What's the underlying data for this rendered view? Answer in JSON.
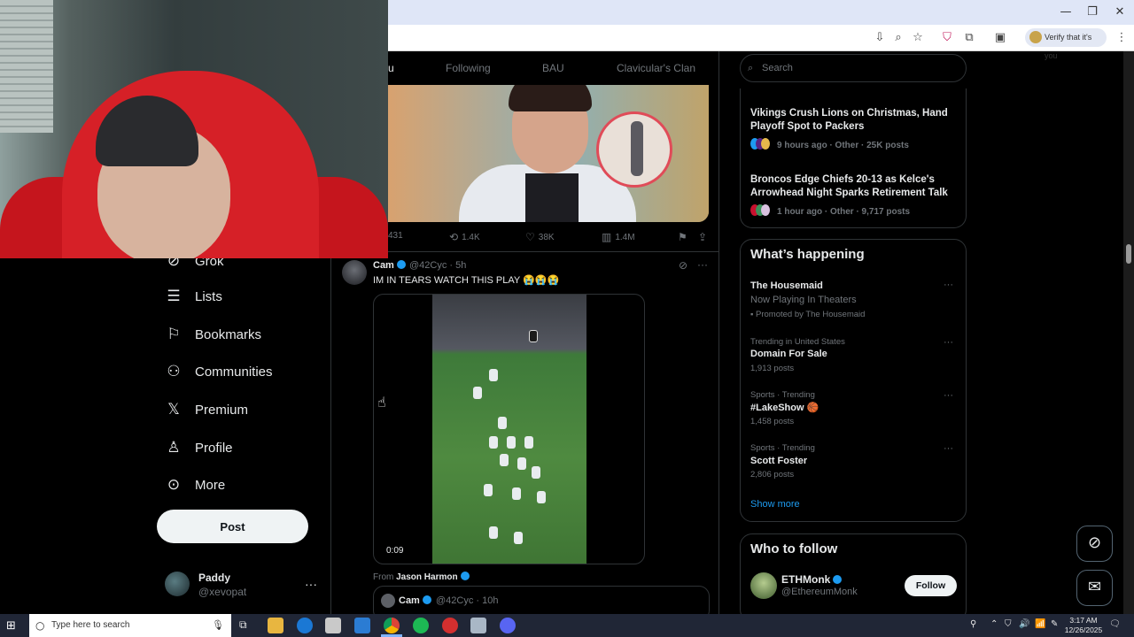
{
  "browser": {
    "verify_label": "Verify that it's you",
    "window_controls": [
      "—",
      "❐",
      "✕"
    ]
  },
  "feed_tabs": [
    {
      "label": "u"
    },
    {
      "label": "Following"
    },
    {
      "label": "BAU"
    },
    {
      "label": "Clavicular's Clan"
    }
  ],
  "post1_actions": {
    "replies": "431",
    "reposts": "1.4K",
    "likes": "38K",
    "views": "1.4M"
  },
  "post2": {
    "name": "Cam",
    "handle": "@42Cyc",
    "time": "5h",
    "text": "IM IN TEARS WATCH THIS PLAY 😭😭😭",
    "video_time": "0:09",
    "from_label": "From",
    "from_name": "Jason Harmon",
    "quote_name": "Cam",
    "quote_handle": "@42Cyc",
    "quote_time": "10h"
  },
  "sidebar": {
    "items": [
      {
        "label": "Grok",
        "icon": "grok-icon"
      },
      {
        "label": "Lists",
        "icon": "list-icon"
      },
      {
        "label": "Bookmarks",
        "icon": "bookmark-icon"
      },
      {
        "label": "Communities",
        "icon": "communities-icon"
      },
      {
        "label": "Premium",
        "icon": "x-icon"
      },
      {
        "label": "Profile",
        "icon": "profile-icon"
      },
      {
        "label": "More",
        "icon": "more-icon"
      }
    ],
    "post_button": "Post",
    "account_name": "Paddy",
    "account_handle": "@xevopat"
  },
  "right": {
    "search_placeholder": "Search",
    "news": [
      {
        "title": "Vikings Crush Lions on Christmas, Hand Playoff Spot to Packers",
        "meta": "9 hours ago · Other · 25K posts"
      },
      {
        "title": "Broncos Edge Chiefs 20-13 as Kelce's Arrowhead Night Sparks Retirement Talk",
        "meta": "1 hour ago · Other · 9,717 posts"
      }
    ],
    "happening_title": "What’s happening",
    "trends": [
      {
        "category": "",
        "name": "The Housemaid",
        "sub": "Now Playing In Theaters",
        "count": "Promoted by The Housemaid"
      },
      {
        "category": "Trending in United States",
        "name": "Domain For Sale",
        "count": "1,913 posts"
      },
      {
        "category": "Sports · Trending",
        "name": "#LakeShow 🏀",
        "count": "1,458 posts"
      },
      {
        "category": "Sports · Trending",
        "name": "Scott Foster",
        "count": "2,806 posts"
      }
    ],
    "show_more": "Show more",
    "wtf_title": "Who to follow",
    "wtf_name": "ETHMonk",
    "wtf_handle": "@EthereumMonk",
    "follow_label": "Follow"
  },
  "taskbar": {
    "search_placeholder": "Type here to search",
    "time": "3:17 AM",
    "date": "12/26/2025"
  },
  "colors": {
    "accent": "#1d9bf0",
    "background": "#000000",
    "taskbar": "#202636"
  }
}
